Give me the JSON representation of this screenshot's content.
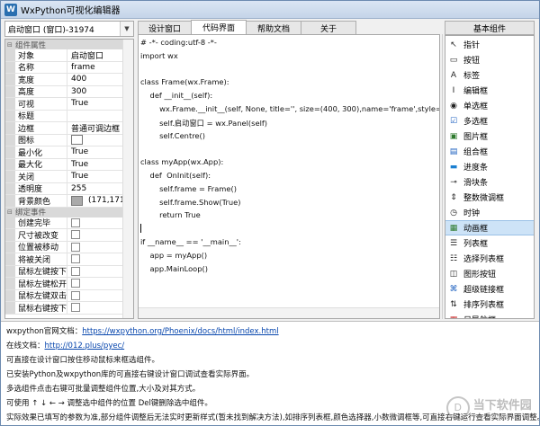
{
  "window": {
    "title": "WxPython可视化编辑器"
  },
  "selector": {
    "value": "启动窗口 (窗口)-31974"
  },
  "props": {
    "category1": "组件属性",
    "rows": [
      {
        "key": "对象",
        "value": "启动窗口"
      },
      {
        "key": "名称",
        "value": "frame"
      },
      {
        "key": "宽度",
        "value": "400"
      },
      {
        "key": "高度",
        "value": "300"
      },
      {
        "key": "可视",
        "value": "True"
      },
      {
        "key": "标题",
        "value": ""
      },
      {
        "key": "边框",
        "value": "普通可调边框"
      },
      {
        "key": "图标",
        "value": ""
      },
      {
        "key": "最小化",
        "value": "True"
      },
      {
        "key": "最大化",
        "value": "True"
      },
      {
        "key": "关闭",
        "value": "True"
      },
      {
        "key": "透明度",
        "value": "255"
      },
      {
        "key": "背景颜色",
        "value": "(171,171,1"
      }
    ],
    "category2": "绑定事件",
    "events": [
      "创建完毕",
      "尺寸被改变",
      "位置被移动",
      "将被关闭",
      "鼠标左键按下",
      "鼠标左键松开",
      "鼠标左键双击",
      "鼠标右键按下"
    ]
  },
  "tabs": [
    "设计窗口",
    "代码界面",
    "帮助文档",
    "关于"
  ],
  "code": [
    "# -*- coding:utf-8 -*-",
    "import wx",
    "",
    "class Frame(wx.Frame):",
    "    def __init__(self):",
    "        wx.Frame.__init__(self, None, title='', size=(400, 300),name='frame',style=541",
    "        self.启动窗口 = wx.Panel(self)",
    "        self.Centre()",
    "",
    "class myApp(wx.App):",
    "    def  OnInit(self):",
    "        self.frame = Frame()",
    "        self.frame.Show(True)",
    "        return True",
    "",
    "if __name__ == '__main__':",
    "    app = myApp()",
    "    app.MainLoop()"
  ],
  "toolbox": {
    "header": "基本组件",
    "items": [
      {
        "label": "指针",
        "icon": "pointer-icon"
      },
      {
        "label": "按钮",
        "icon": "button-icon"
      },
      {
        "label": "标签",
        "icon": "label-icon"
      },
      {
        "label": "编辑框",
        "icon": "textbox-icon"
      },
      {
        "label": "单选框",
        "icon": "radio-icon"
      },
      {
        "label": "多选框",
        "icon": "checkbox-icon"
      },
      {
        "label": "图片框",
        "icon": "image-icon"
      },
      {
        "label": "组合框",
        "icon": "combobox-icon"
      },
      {
        "label": "进度条",
        "icon": "progressbar-icon"
      },
      {
        "label": "滑块条",
        "icon": "slider-icon"
      },
      {
        "label": "整数微调框",
        "icon": "spin-icon"
      },
      {
        "label": "时钟",
        "icon": "clock-icon"
      },
      {
        "label": "动画框",
        "icon": "animation-icon"
      },
      {
        "label": "列表框",
        "icon": "listbox-icon"
      },
      {
        "label": "选择列表框",
        "icon": "checklist-icon"
      },
      {
        "label": "图形按钮",
        "icon": "bitmap-button-icon"
      },
      {
        "label": "超级链接框",
        "icon": "hyperlink-icon"
      },
      {
        "label": "排序列表框",
        "icon": "sortlist-icon"
      },
      {
        "label": "日导航框",
        "icon": "calendar-icon"
      }
    ]
  },
  "info": {
    "line1_prefix": "wxpython官网文档：",
    "line1_link": "https://wxpython.org/Phoenix/docs/html/index.html",
    "line2_prefix": "在线文档：",
    "line2_link": "http://012.plus/pyec/",
    "line3": "可直接在设计窗口按住移动鼠标来框选组件。",
    "line4": "已安装Python及wxpython库的可直接右键设计窗口调试查看实际界面。",
    "line5": "多选组件点击右键可批量调整组件位置,大小及对其方式。",
    "line6": "可使用 ↑ ↓ ← → 调整选中组件的位置 Del键删除选中组件。",
    "line7": "实际效果已填写的参数为准,部分组件调整后无法实时更新样式(暂未找到解决方法),如排序列表框,颜色选择器,小数微调框等,可直接右键运行查看实际界面调整。"
  },
  "watermark": {
    "brand": "当下软件园",
    "sub": "www.downxia.com"
  }
}
